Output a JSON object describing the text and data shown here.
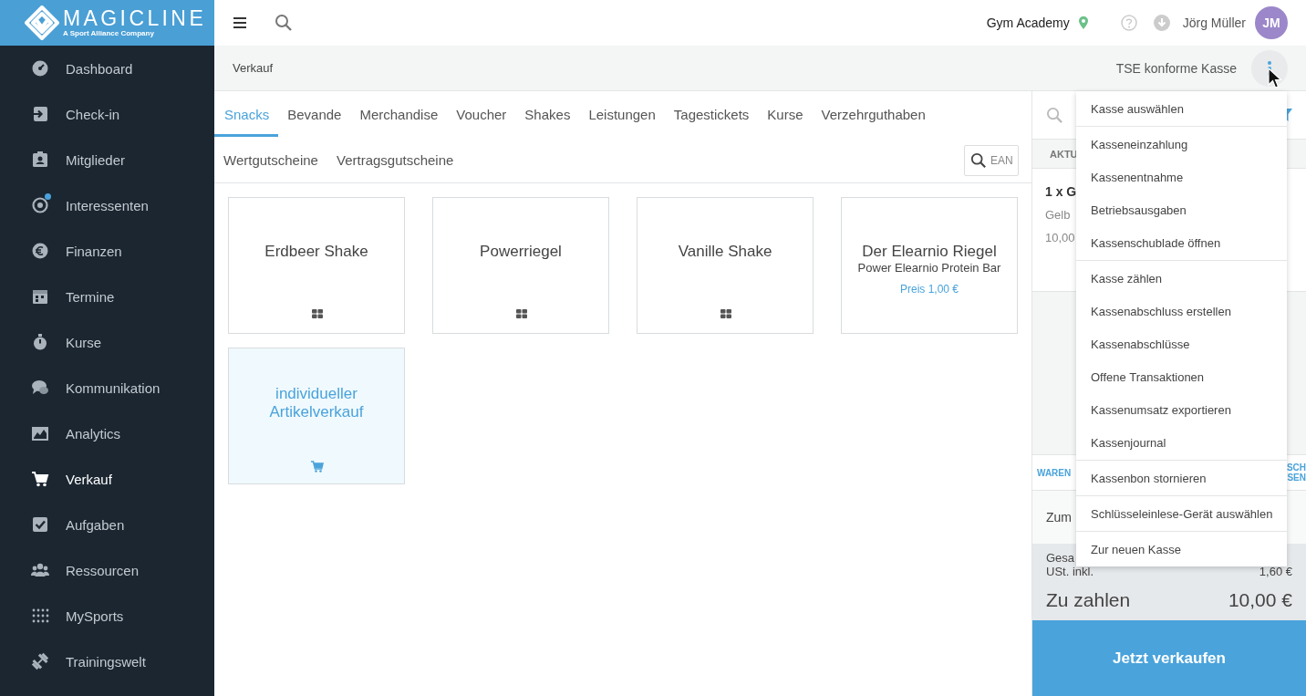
{
  "logo": {
    "name": "MAGICLINE",
    "tagline": "A Sport Alliance Company"
  },
  "sidebar": {
    "items": [
      {
        "label": "Dashboard",
        "selected": false,
        "notification": false
      },
      {
        "label": "Check-in",
        "selected": false,
        "notification": false
      },
      {
        "label": "Mitglieder",
        "selected": false,
        "notification": false
      },
      {
        "label": "Interessenten",
        "selected": false,
        "notification": true
      },
      {
        "label": "Finanzen",
        "selected": false,
        "notification": false
      },
      {
        "label": "Termine",
        "selected": false,
        "notification": false
      },
      {
        "label": "Kurse",
        "selected": false,
        "notification": false
      },
      {
        "label": "Kommunikation",
        "selected": false,
        "notification": false
      },
      {
        "label": "Analytics",
        "selected": false,
        "notification": false
      },
      {
        "label": "Verkauf",
        "selected": true,
        "notification": false
      },
      {
        "label": "Aufgaben",
        "selected": false,
        "notification": false
      },
      {
        "label": "Ressourcen",
        "selected": false,
        "notification": false
      },
      {
        "label": "MySports",
        "selected": false,
        "notification": false
      },
      {
        "label": "Trainingswelt",
        "selected": false,
        "notification": false
      }
    ]
  },
  "topbar": {
    "location": "Gym Academy",
    "user": "Jörg Müller",
    "avatar": "JM"
  },
  "page": {
    "title": "Verkauf",
    "register": "TSE konforme Kasse"
  },
  "tabs": [
    {
      "label": "Snacks",
      "selected": true
    },
    {
      "label": "Bevande",
      "selected": false
    },
    {
      "label": "Merchandise",
      "selected": false
    },
    {
      "label": "Voucher",
      "selected": false
    },
    {
      "label": "Shakes",
      "selected": false
    },
    {
      "label": "Leistungen",
      "selected": false
    },
    {
      "label": "Tagestickets",
      "selected": false
    },
    {
      "label": "Kurse",
      "selected": false
    },
    {
      "label": "Verzehrguthaben",
      "selected": false
    },
    {
      "label": "Wertgutscheine",
      "selected": false
    },
    {
      "label": "Vertragsgutscheine",
      "selected": false
    }
  ],
  "ean_search": {
    "placeholder": "EAN"
  },
  "products": [
    {
      "kind": "group",
      "name": "Erdbeer Shake"
    },
    {
      "kind": "group",
      "name": "Powerriegel"
    },
    {
      "kind": "group",
      "name": "Vanille Shake"
    },
    {
      "kind": "item",
      "name": "Der Elearnio Riegel",
      "subtitle": "Power Elearnio Protein Bar",
      "price": "Preis 1,00 €"
    },
    {
      "kind": "custom",
      "name": "individueller Artikelverkauf"
    }
  ],
  "cart": {
    "header": "AKTU",
    "line": {
      "title": "1 x G",
      "detail": "Gelb",
      "amount": "10,00"
    },
    "tab_left": "WAREN",
    "tab_right": [
      "SCH",
      "SEN"
    ],
    "note": "Zum",
    "total_label": "Gesa",
    "tax_label": "USt. inkl.",
    "tax": "1,60 €",
    "due_label": "Zu zahlen",
    "due": "10,00 €",
    "checkout": "Jetzt verkaufen"
  },
  "menu": {
    "groups": [
      [
        "Kasse auswählen"
      ],
      [
        "Kasseneinzahlung",
        "Kassenentnahme",
        "Betriebsausgaben",
        "Kassenschublade öffnen"
      ],
      [
        "Kasse zählen",
        "Kassenabschluss erstellen",
        "Kassenabschlüsse",
        "Offene Transaktionen",
        "Kassenumsatz exportieren",
        "Kassenjournal"
      ],
      [
        "Kassenbon stornieren"
      ],
      [
        "Schlüsseleinlese-Gerät auswählen"
      ],
      [
        "Zur neuen Kasse"
      ]
    ]
  }
}
